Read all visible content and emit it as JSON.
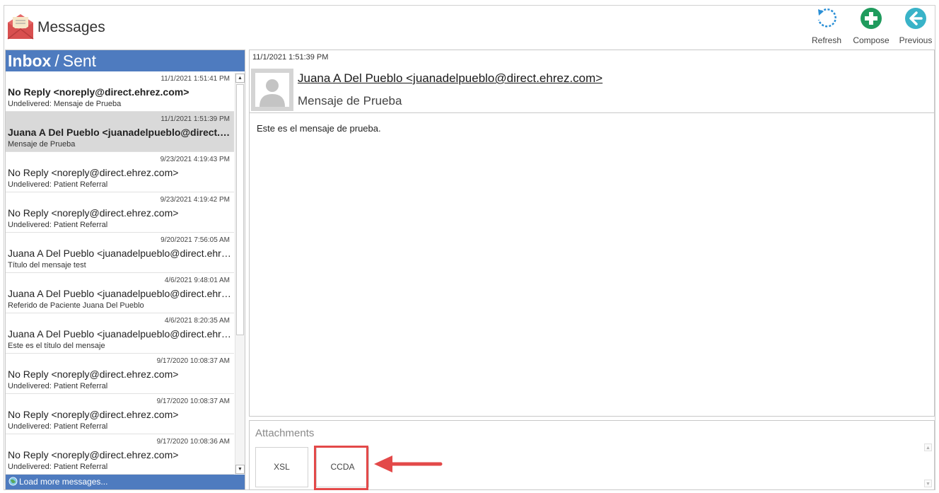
{
  "app": {
    "title": "Messages"
  },
  "toolbar": {
    "refresh_label": "Refresh",
    "compose_label": "Compose",
    "previous_label": "Previous"
  },
  "tabs": {
    "inbox": "Inbox",
    "separator": "/",
    "sent": "Sent"
  },
  "messages": [
    {
      "date": "11/1/2021 1:51:41 PM",
      "from": "No Reply <noreply@direct.ehrez.com>",
      "subject": "Undelivered: Mensaje de Prueba",
      "bold": true,
      "selected": false
    },
    {
      "date": "11/1/2021 1:51:39 PM",
      "from": "Juana A Del Pueblo <juanadelpueblo@direct.ehrez.com>",
      "subject": "Mensaje de Prueba",
      "bold": true,
      "selected": true
    },
    {
      "date": "9/23/2021 4:19:43 PM",
      "from": "No Reply <noreply@direct.ehrez.com>",
      "subject": "Undelivered: Patient Referral",
      "bold": false,
      "selected": false
    },
    {
      "date": "9/23/2021 4:19:42 PM",
      "from": "No Reply <noreply@direct.ehrez.com>",
      "subject": "Undelivered: Patient Referral",
      "bold": false,
      "selected": false
    },
    {
      "date": "9/20/2021 7:56:05 AM",
      "from": "Juana A Del Pueblo <juanadelpueblo@direct.ehrez.com>",
      "subject": "Título del mensaje test",
      "bold": false,
      "selected": false
    },
    {
      "date": "4/6/2021 9:48:01 AM",
      "from": "Juana A Del Pueblo <juanadelpueblo@direct.ehrez.com>",
      "subject": "Referido de Paciente Juana Del Pueblo",
      "bold": false,
      "selected": false
    },
    {
      "date": "4/6/2021 8:20:35 AM",
      "from": "Juana A Del Pueblo <juanadelpueblo@direct.ehrez.com>",
      "subject": "Este es el título del mensaje",
      "bold": false,
      "selected": false
    },
    {
      "date": "9/17/2020 10:08:37 AM",
      "from": "No Reply <noreply@direct.ehrez.com>",
      "subject": "Undelivered: Patient Referral",
      "bold": false,
      "selected": false
    },
    {
      "date": "9/17/2020 10:08:37 AM",
      "from": "No Reply <noreply@direct.ehrez.com>",
      "subject": "Undelivered: Patient Referral",
      "bold": false,
      "selected": false
    },
    {
      "date": "9/17/2020 10:08:36 AM",
      "from": "No Reply <noreply@direct.ehrez.com>",
      "subject": "Undelivered: Patient Referral",
      "bold": false,
      "selected": false
    }
  ],
  "load_more_label": "Load more messages...",
  "selected_message": {
    "timestamp": "11/1/2021 1:51:39 PM",
    "sender": "Juana A Del Pueblo <juanadelpueblo@direct.ehrez.com>",
    "subject": "Mensaje de Prueba",
    "body": "Este es el mensaje de prueba."
  },
  "attachments": {
    "label": "Attachments",
    "items": [
      "XSL",
      "CCDA"
    ],
    "highlighted": "CCDA"
  },
  "colors": {
    "header_blue": "#4e7bbf",
    "selected_row": "#d9d9d9",
    "highlight_red": "#e34949",
    "compose_green": "#1f9b5d",
    "previous_teal": "#39b3c8",
    "refresh_blue": "#2a8fd6"
  },
  "icons": {
    "app": "envelope-icon",
    "refresh": "refresh-icon",
    "compose": "plus-circle-icon",
    "previous": "arrow-left-circle-icon",
    "load_more": "globe-icon",
    "avatar": "person-silhouette-icon"
  }
}
